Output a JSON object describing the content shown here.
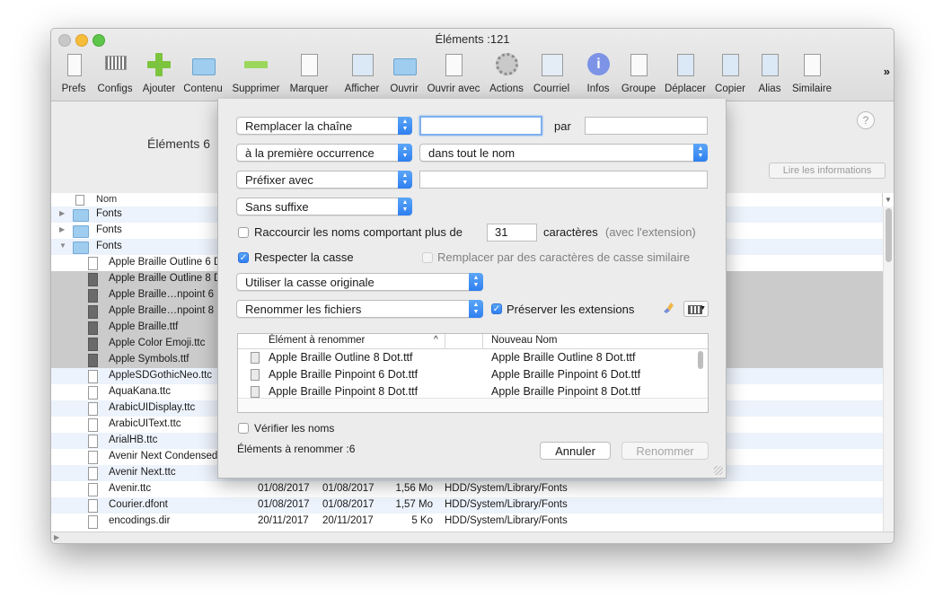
{
  "window": {
    "title": "Éléments :121"
  },
  "toolbar": {
    "items": [
      {
        "label": "Prefs",
        "icon": "prefs-icon"
      },
      {
        "label": "Configs",
        "icon": "configs-icon"
      },
      {
        "label": "Ajouter",
        "icon": "add-icon"
      },
      {
        "label": "Contenu",
        "icon": "folder-add-icon"
      },
      {
        "label": "Supprimer",
        "icon": "remove-icon"
      },
      {
        "label": "Marquer",
        "icon": "mark-icon"
      },
      {
        "label": "Afficher",
        "icon": "display-icon"
      },
      {
        "label": "Ouvrir",
        "icon": "open-icon"
      },
      {
        "label": "Ouvrir avec",
        "icon": "open-with-icon"
      },
      {
        "label": "Actions",
        "icon": "gear-icon"
      },
      {
        "label": "Courriel",
        "icon": "mail-icon"
      },
      {
        "label": "Infos",
        "icon": "info-icon"
      },
      {
        "label": "Groupe",
        "icon": "group-icon"
      },
      {
        "label": "Déplacer",
        "icon": "move-icon"
      },
      {
        "label": "Copier",
        "icon": "copy-icon"
      },
      {
        "label": "Alias",
        "icon": "alias-icon"
      },
      {
        "label": "Similaire",
        "icon": "similar-icon"
      }
    ],
    "more": "»"
  },
  "header": {
    "elements_count": "Éléments  6",
    "help": "?",
    "info_button": "Lire les informations"
  },
  "list": {
    "column_name": "Nom",
    "rows": [
      {
        "name": "Fonts",
        "folder": true,
        "disclosure": "▶",
        "state": "alt",
        "d1": "",
        "d2": "",
        "size": "",
        "path": ""
      },
      {
        "name": "Fonts",
        "folder": true,
        "disclosure": "▶",
        "state": "",
        "d1": "",
        "d2": "",
        "size": "",
        "path": ""
      },
      {
        "name": "Fonts",
        "folder": true,
        "disclosure": "▼",
        "state": "alt",
        "d1": "",
        "d2": "",
        "size": "",
        "path": ""
      },
      {
        "name": "Apple Braille Outline 6 Dot.ttf",
        "state": "",
        "d1": "",
        "d2": "",
        "size": "",
        "path": ""
      },
      {
        "name": "Apple Braille Outline 8 Dot.ttf",
        "state": "sel",
        "d1": "",
        "d2": "",
        "size": "",
        "path": ""
      },
      {
        "name": "Apple Braille…npoint 6 Dot.ttf",
        "state": "sel",
        "d1": "",
        "d2": "",
        "size": "",
        "path": ""
      },
      {
        "name": "Apple Braille…npoint 8 Dot.ttf",
        "state": "sel",
        "d1": "",
        "d2": "",
        "size": "",
        "path": ""
      },
      {
        "name": "Apple Braille.ttf",
        "state": "sel",
        "d1": "",
        "d2": "",
        "size": "",
        "path": ""
      },
      {
        "name": "Apple Color Emoji.ttc",
        "state": "sel",
        "d1": "",
        "d2": "",
        "size": "",
        "path": ""
      },
      {
        "name": "Apple Symbols.ttf",
        "state": "sel",
        "d1": "",
        "d2": "",
        "size": "",
        "path": ""
      },
      {
        "name": "AppleSDGothicNeo.ttc",
        "state": "alt",
        "d1": "",
        "d2": "",
        "size": "",
        "path": ""
      },
      {
        "name": "AquaKana.ttc",
        "state": "",
        "d1": "",
        "d2": "",
        "size": "",
        "path": ""
      },
      {
        "name": "ArabicUIDisplay.ttc",
        "state": "alt",
        "d1": "",
        "d2": "",
        "size": "",
        "path": ""
      },
      {
        "name": "ArabicUIText.ttc",
        "state": "",
        "d1": "",
        "d2": "",
        "size": "",
        "path": ""
      },
      {
        "name": "ArialHB.ttc",
        "state": "alt",
        "d1": "",
        "d2": "",
        "size": "",
        "path": ""
      },
      {
        "name": "Avenir Next Condensed.ttc",
        "state": "",
        "d1": "",
        "d2": "",
        "size": "",
        "path": ""
      },
      {
        "name": "Avenir Next.ttc",
        "state": "alt",
        "d1": "",
        "d2": "",
        "size": "",
        "path": ""
      },
      {
        "name": "Avenir.ttc",
        "state": "",
        "d1": "01/08/2017",
        "d2": "01/08/2017",
        "size": "1,56 Mo",
        "path": "HDD/System/Library/Fonts"
      },
      {
        "name": "Courier.dfont",
        "state": "alt",
        "d1": "01/08/2017",
        "d2": "01/08/2017",
        "size": "1,57 Mo",
        "path": "HDD/System/Library/Fonts"
      },
      {
        "name": "encodings.dir",
        "state": "",
        "d1": "20/11/2017",
        "d2": "20/11/2017",
        "size": "5 Ko",
        "path": "HDD/System/Library/Fonts"
      }
    ]
  },
  "sheet": {
    "replace_popup": "Remplacer la chaîne",
    "replace_value": "",
    "par_label": "par",
    "par_value": "",
    "occurrence_popup": "à la première occurrence",
    "scope_popup": "dans tout le nom",
    "prefix_popup": "Préfixer avec",
    "prefix_value": "",
    "suffix_popup": "Sans suffixe",
    "shorten_label": "Raccourcir les noms comportant plus de",
    "shorten_value": "31",
    "chars_label": "caractères",
    "chars_note": "(avec l'extension)",
    "case_label": "Respecter la casse",
    "similar_case_label": "Remplacer par des caractères de casse similaire",
    "case_popup": "Utiliser la casse originale",
    "rename_popup": "Renommer les fichiers",
    "preserve_label": "Préserver les extensions",
    "table": {
      "col_from": "Élément à renommer",
      "col_to": "Nouveau Nom",
      "rows": [
        {
          "from": "Apple Braille Outline 8 Dot.ttf",
          "to": "Apple Braille Outline 8 Dot.ttf"
        },
        {
          "from": "Apple Braille Pinpoint 6 Dot.ttf",
          "to": "Apple Braille Pinpoint 6 Dot.ttf"
        },
        {
          "from": "Apple Braille Pinpoint 8 Dot.ttf",
          "to": "Apple Braille Pinpoint 8 Dot.ttf"
        }
      ]
    },
    "verify_label": "Vérifier les noms",
    "count_label": "Éléments à renommer :6",
    "cancel": "Annuler",
    "rename": "Renommer"
  }
}
